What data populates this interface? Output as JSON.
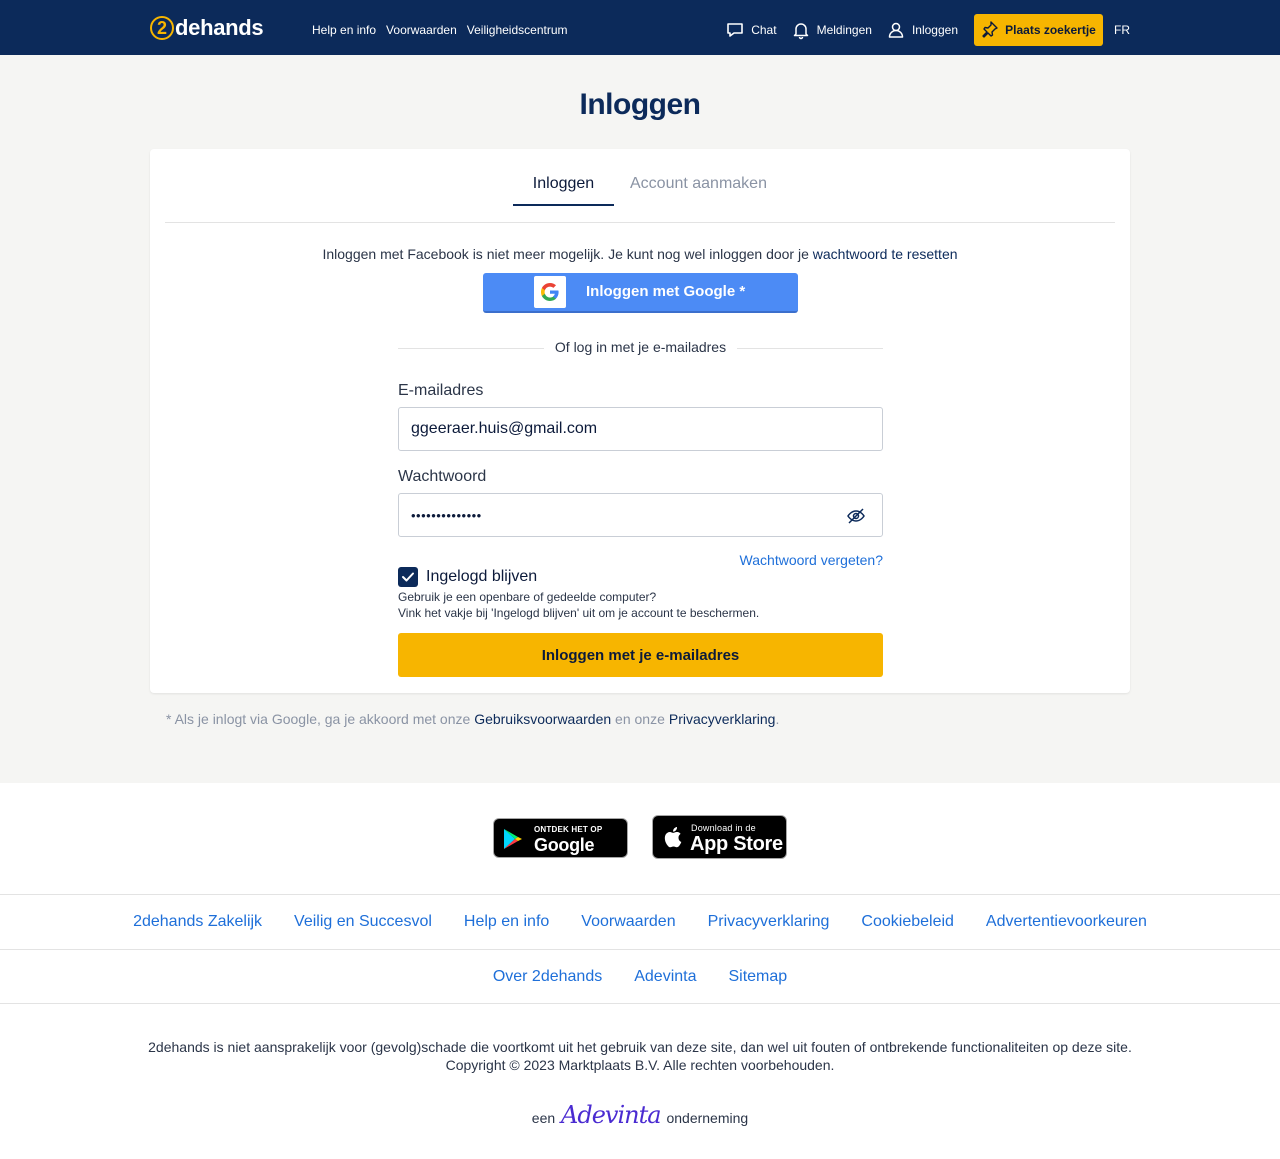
{
  "header": {
    "logo_digit": "2",
    "logo_word": "dehands",
    "nav": [
      "Help en info",
      "Voorwaarden",
      "Veiligheidscentrum"
    ],
    "chat": "Chat",
    "notifications": "Meldingen",
    "login": "Inloggen",
    "place_ad": "Plaats zoekertje",
    "language": "FR"
  },
  "page": {
    "title": "Inloggen"
  },
  "tabs": {
    "login": "Inloggen",
    "register": "Account aanmaken"
  },
  "login_form": {
    "facebook_note": "Inloggen met Facebook is niet meer mogelijk. Je kunt nog wel inloggen door je",
    "reset_link": "wachtwoord te resetten",
    "google_button": "Inloggen met Google *",
    "divider": "Of log in met je e-mailadres",
    "email_label": "E-mailadres",
    "email_value": "ggeeraer.huis@gmail.com",
    "password_label": "Wachtwoord",
    "password_value": "••••••••••••••",
    "forgot_link": "Wachtwoord vergeten?",
    "remember_label": "Ingelogd blijven",
    "remember_checked": true,
    "hint_line1": "Gebruik je een openbare of gedeelde computer?",
    "hint_line2": "Vink het vakje bij 'Ingelogd blijven' uit om je account te beschermen.",
    "submit": "Inloggen met je e-mailadres"
  },
  "consent": {
    "prefix": "* Als je inlogt via Google, ga je akkoord met onze",
    "terms": "Gebruiksvoorwaarden",
    "middle": "en onze",
    "privacy": "Privacyverklaring",
    "suffix": "."
  },
  "footer": {
    "google_play_small": "ONTDEK HET OP",
    "google_play_big": "Google Play",
    "app_store_small": "Download in de",
    "app_store_big": "App Store",
    "links_row1": [
      "2dehands Zakelijk",
      "Veilig en Succesvol",
      "Help en info",
      "Voorwaarden",
      "Privacyverklaring",
      "Cookiebeleid",
      "Advertentievoorkeuren"
    ],
    "links_row2": [
      "Over 2dehands",
      "Adevinta",
      "Sitemap"
    ],
    "disclaimer": "2dehands is niet aansprakelijk voor (gevolg)schade die voortkomt uit het gebruik van deze site, dan wel uit fouten of ontbrekende functionaliteiten op deze site.",
    "copyright": "Copyright © 2023 Marktplaats B.V. Alle rechten voorbehouden.",
    "adevinta_prefix": "een",
    "adevinta_logo": "Adevinta",
    "adevinta_suffix": "onderneming"
  },
  "colors": {
    "header_bg": "#0c2a5a",
    "accent_yellow": "#f7b500",
    "google_blue": "#4c8bf5",
    "link_blue": "#1e6fd9",
    "adevinta_purple": "#4a2bd1"
  },
  "icons": [
    "chat-icon",
    "bell-icon",
    "user-icon",
    "pin-icon",
    "google-logo-icon",
    "eye-off-icon",
    "checkmark-icon",
    "google-play-icon",
    "apple-icon"
  ]
}
